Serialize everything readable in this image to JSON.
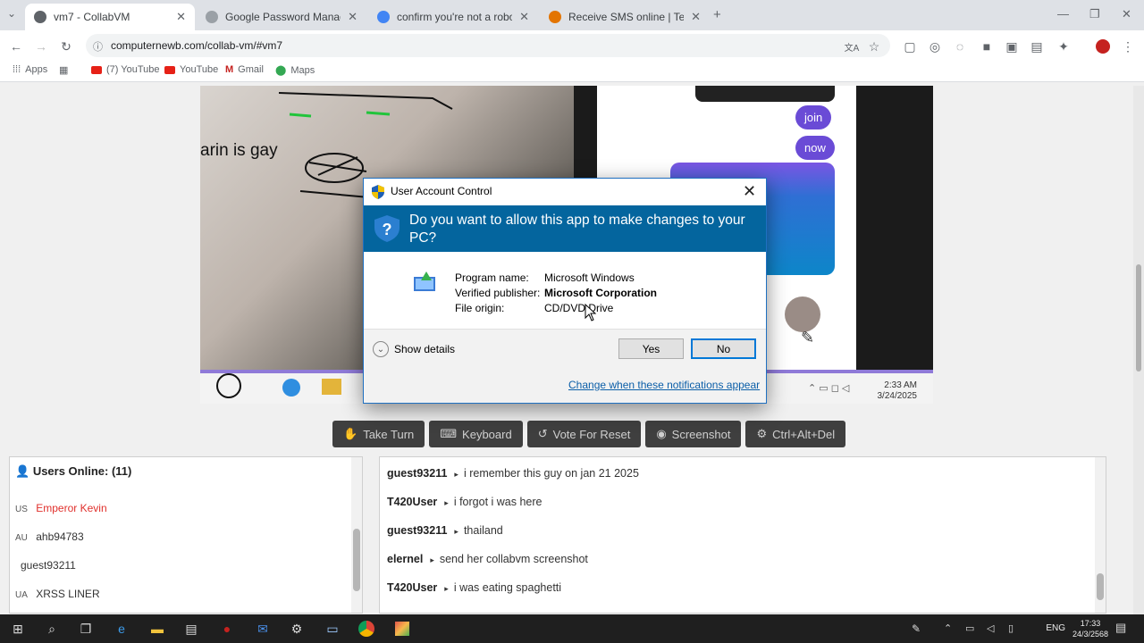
{
  "browser": {
    "tabs": [
      {
        "title": "vm7 - CollabVM",
        "active": true
      },
      {
        "title": "Google Password Manager",
        "active": false
      },
      {
        "title": "confirm you're not a robot go...",
        "active": false
      },
      {
        "title": "Receive SMS online | Temporar...",
        "active": false
      }
    ],
    "address": "computernewb.com/collab-vm/#vm7",
    "bookmarks": [
      "Apps",
      "(7) YouTube",
      "YouTube",
      "Gmail",
      "Maps"
    ]
  },
  "vm": {
    "photo_caption": "arin is gay",
    "chat_bubbles": [
      "join",
      "now"
    ],
    "clock_time": "2:33 AM",
    "clock_date": "3/24/2025"
  },
  "vm_buttons": [
    {
      "icon": "hand-icon",
      "label": "Take Turn"
    },
    {
      "icon": "keyboard-icon",
      "label": "Keyboard"
    },
    {
      "icon": "reset-icon",
      "label": "Vote For Reset"
    },
    {
      "icon": "camera-icon",
      "label": "Screenshot"
    },
    {
      "icon": "gear-icon",
      "label": "Ctrl+Alt+Del"
    }
  ],
  "users": {
    "header": "Users Online: (11)",
    "list": [
      {
        "flag": "US",
        "name": "Emperor Kevin",
        "color": "#e0302c"
      },
      {
        "flag": "AU",
        "name": "ahb94783",
        "color": "#333333"
      },
      {
        "flag": "",
        "name": "guest93211",
        "color": "#333333"
      },
      {
        "flag": "UA",
        "name": "XRSS LINER",
        "color": "#333333"
      }
    ]
  },
  "chat": [
    {
      "nick": "guest93211",
      "message": "i remember this guy on jan 21 2025"
    },
    {
      "nick": "T420User",
      "message": "i forgot i was here"
    },
    {
      "nick": "guest93211",
      "message": "thailand"
    },
    {
      "nick": "elernel",
      "message": "send her collabvm screenshot"
    },
    {
      "nick": "T420User",
      "message": "i was eating spaghetti"
    }
  ],
  "uac": {
    "title": "User Account Control",
    "question": "Do you want to allow this app to make changes to your PC?",
    "program_label": "Program name:",
    "program_value": "Microsoft Windows",
    "publisher_label": "Verified publisher:",
    "publisher_value": "Microsoft Corporation",
    "origin_label": "File origin:",
    "origin_value": "CD/DVD Drive",
    "show_details": "Show details",
    "yes": "Yes",
    "no": "No",
    "change_link": "Change when these notifications appear"
  },
  "host_taskbar": {
    "lang": "ENG",
    "time": "17:33",
    "date": "24/3/2568"
  }
}
